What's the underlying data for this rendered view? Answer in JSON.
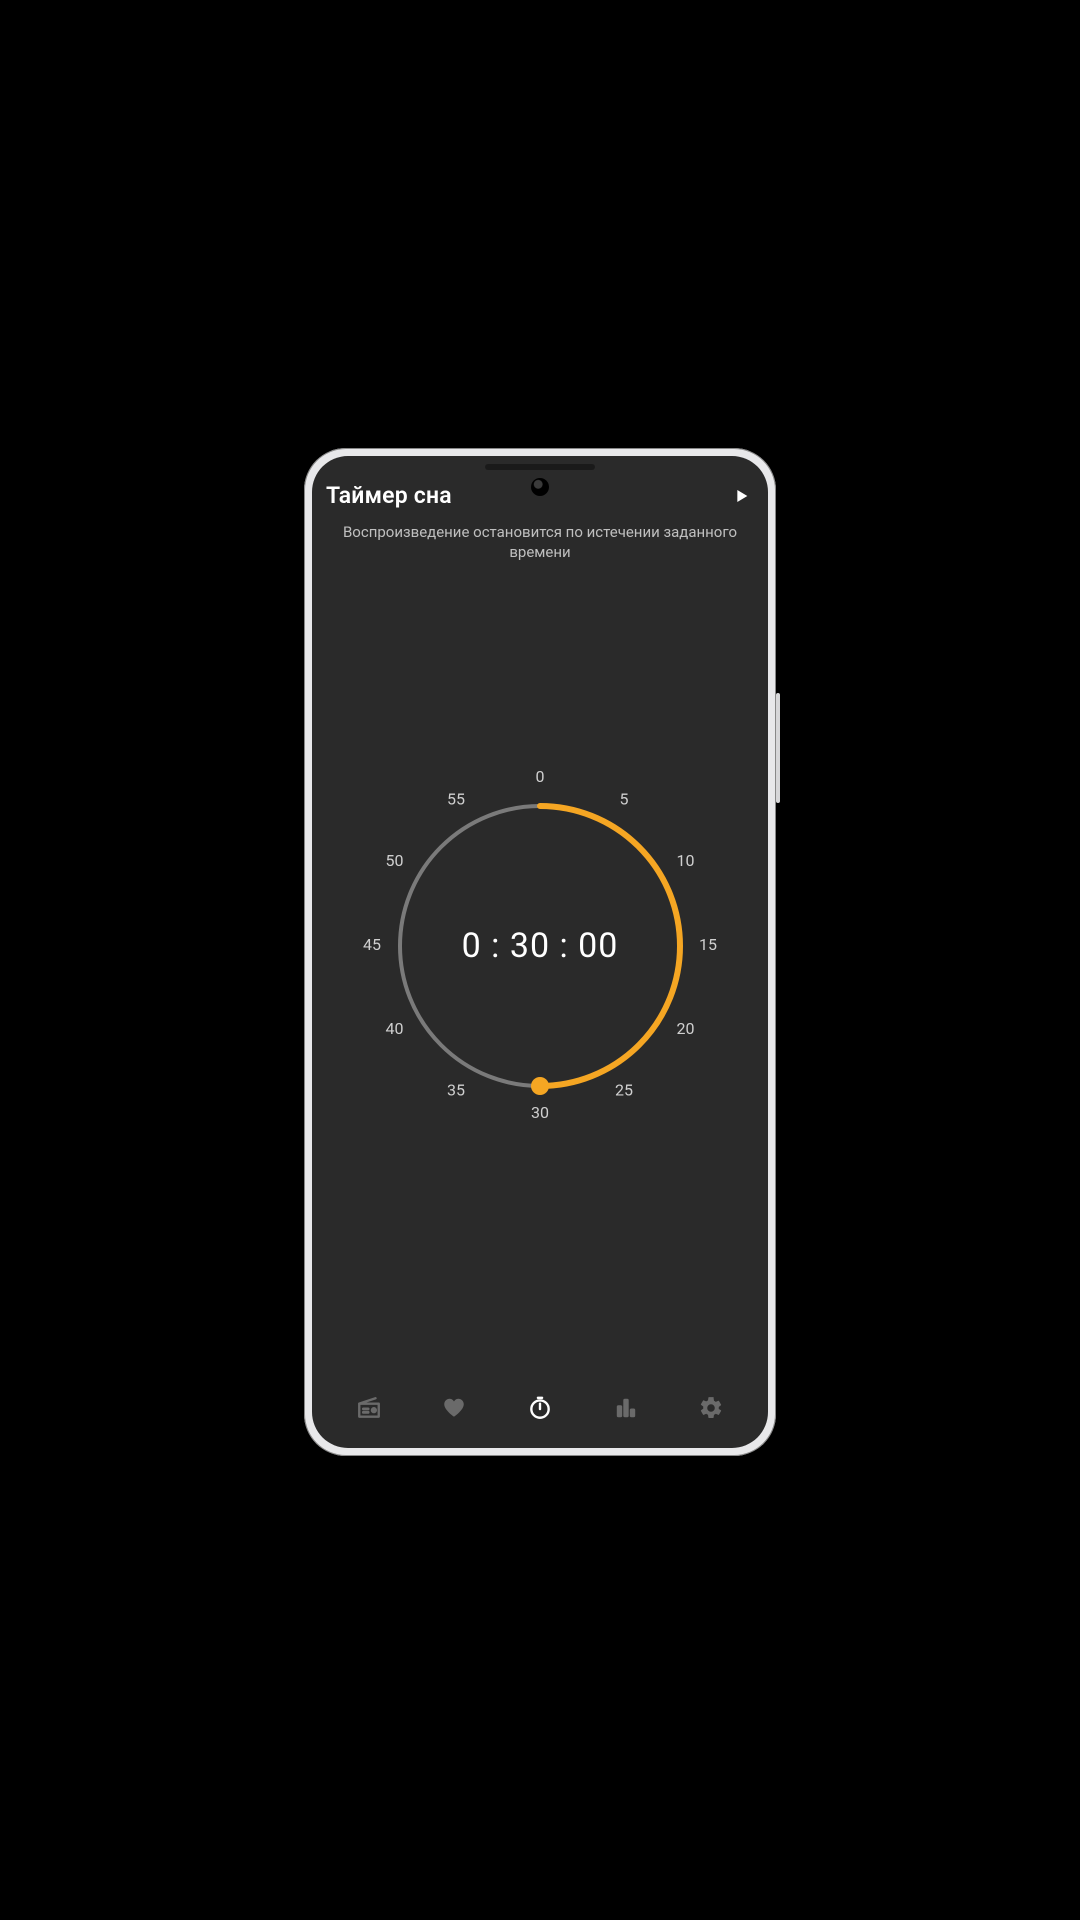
{
  "header": {
    "title": "Таймер сна",
    "play_icon": "play-icon"
  },
  "subtitle": "Воспроизведение остановится по истечении заданного времени",
  "timer": {
    "readout": "0 : 30 : 00",
    "selected_minutes": 30,
    "ticks": [
      "0",
      "5",
      "10",
      "15",
      "20",
      "25",
      "30",
      "35",
      "40",
      "45",
      "50",
      "55"
    ]
  },
  "colors": {
    "accent": "#f5a623",
    "ring_inactive": "#7a7a7a",
    "bg": "#2a2a2a"
  },
  "nav": {
    "items": [
      {
        "name": "radio",
        "active": false
      },
      {
        "name": "favorites",
        "active": false
      },
      {
        "name": "timer",
        "active": true
      },
      {
        "name": "equalizer",
        "active": false
      },
      {
        "name": "settings",
        "active": false
      }
    ]
  }
}
